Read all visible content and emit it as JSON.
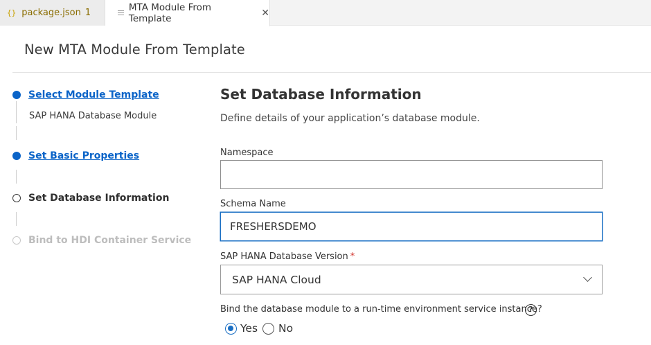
{
  "tabs": [
    {
      "icon": "{}",
      "label": "package.json",
      "badge": "1"
    },
    {
      "label": "MTA Module From Template",
      "close": "✕"
    }
  ],
  "page": {
    "title": "New MTA Module From Template"
  },
  "steps": [
    {
      "label": "Select Module Template",
      "sub": "SAP HANA Database Module",
      "state": "completed"
    },
    {
      "label": "Set Basic Properties",
      "state": "completed"
    },
    {
      "label": "Set Database Information",
      "state": "current"
    },
    {
      "label": "Bind to HDI Container Service",
      "state": "disabled"
    }
  ],
  "form": {
    "title": "Set Database Information",
    "description": "Define details of your application’s database module.",
    "namespace": {
      "label": "Namespace",
      "value": ""
    },
    "schema": {
      "label": "Schema Name",
      "value": "FRESHERSDEMO"
    },
    "version": {
      "label": "SAP HANA Database Version",
      "required": "*",
      "value": "SAP HANA Cloud"
    },
    "bind": {
      "question": "Bind the database module to a run-time environment service instance?",
      "help": "?",
      "options": [
        "Yes",
        "No"
      ],
      "selected": "Yes"
    }
  },
  "colors": {
    "accent": "#0b64c8",
    "focus": "#1a6fc4",
    "required": "#d0342c"
  }
}
